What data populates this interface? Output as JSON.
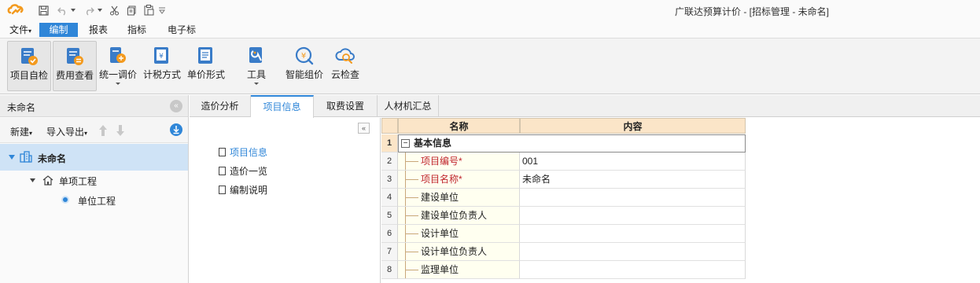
{
  "window": {
    "title": "广联达预算计价 - [招标管理 - 未命名]"
  },
  "menu": [
    {
      "label": "文件",
      "has_dropdown": true
    },
    {
      "label": "编制",
      "active": true
    },
    {
      "label": "报表"
    },
    {
      "label": "指标"
    },
    {
      "label": "电子标"
    }
  ],
  "ribbon": [
    {
      "label": "项目自检",
      "icon": "project-check-icon",
      "boxed": true
    },
    {
      "label": "费用查看",
      "icon": "cost-view-icon",
      "boxed": true
    },
    {
      "label": "统一调价",
      "icon": "unified-price-adjust-icon",
      "has_dropdown": true
    },
    {
      "label": "计税方式",
      "icon": "tax-method-icon"
    },
    {
      "label": "单价形式",
      "icon": "unit-price-form-icon"
    },
    {
      "label": "工具",
      "icon": "tools-icon",
      "has_dropdown": true
    },
    {
      "label": "智能组价",
      "icon": "smart-pricing-icon"
    },
    {
      "label": "云检查",
      "icon": "cloud-check-icon"
    }
  ],
  "left_panel": {
    "title": "未命名",
    "toolbar": {
      "new_label": "新建",
      "import_export_label": "导入导出"
    },
    "tree": {
      "root": "未命名",
      "child": "单项工程",
      "grandchild": "单位工程"
    }
  },
  "tabs": [
    {
      "label": "造价分析"
    },
    {
      "label": "项目信息",
      "active": true
    },
    {
      "label": "取费设置"
    },
    {
      "label": "人材机汇总"
    }
  ],
  "nav": {
    "collapse_label": "«",
    "items": [
      {
        "label": "项目信息",
        "active": true
      },
      {
        "label": "造价一览"
      },
      {
        "label": "编制说明"
      }
    ]
  },
  "grid": {
    "headers": {
      "name": "名称",
      "content": "内容"
    },
    "group": {
      "row": "1",
      "label": "基本信息",
      "toggle": "−"
    },
    "rows": [
      {
        "num": "2",
        "name": "项目编号*",
        "content": "001",
        "required": true
      },
      {
        "num": "3",
        "name": "项目名称*",
        "content": "未命名",
        "required": true
      },
      {
        "num": "4",
        "name": "建设单位",
        "content": ""
      },
      {
        "num": "5",
        "name": "建设单位负责人",
        "content": ""
      },
      {
        "num": "6",
        "name": "设计单位",
        "content": ""
      },
      {
        "num": "7",
        "name": "设计单位负责人",
        "content": ""
      },
      {
        "num": "8",
        "name": "监理单位",
        "content": ""
      }
    ]
  },
  "colors": {
    "accent": "#2f86d8",
    "required_text": "#c0262e",
    "grid_header_bg": "#fbe5c8",
    "selected_tree_bg": "#cfe3f6",
    "logo": "#f39a1e"
  }
}
